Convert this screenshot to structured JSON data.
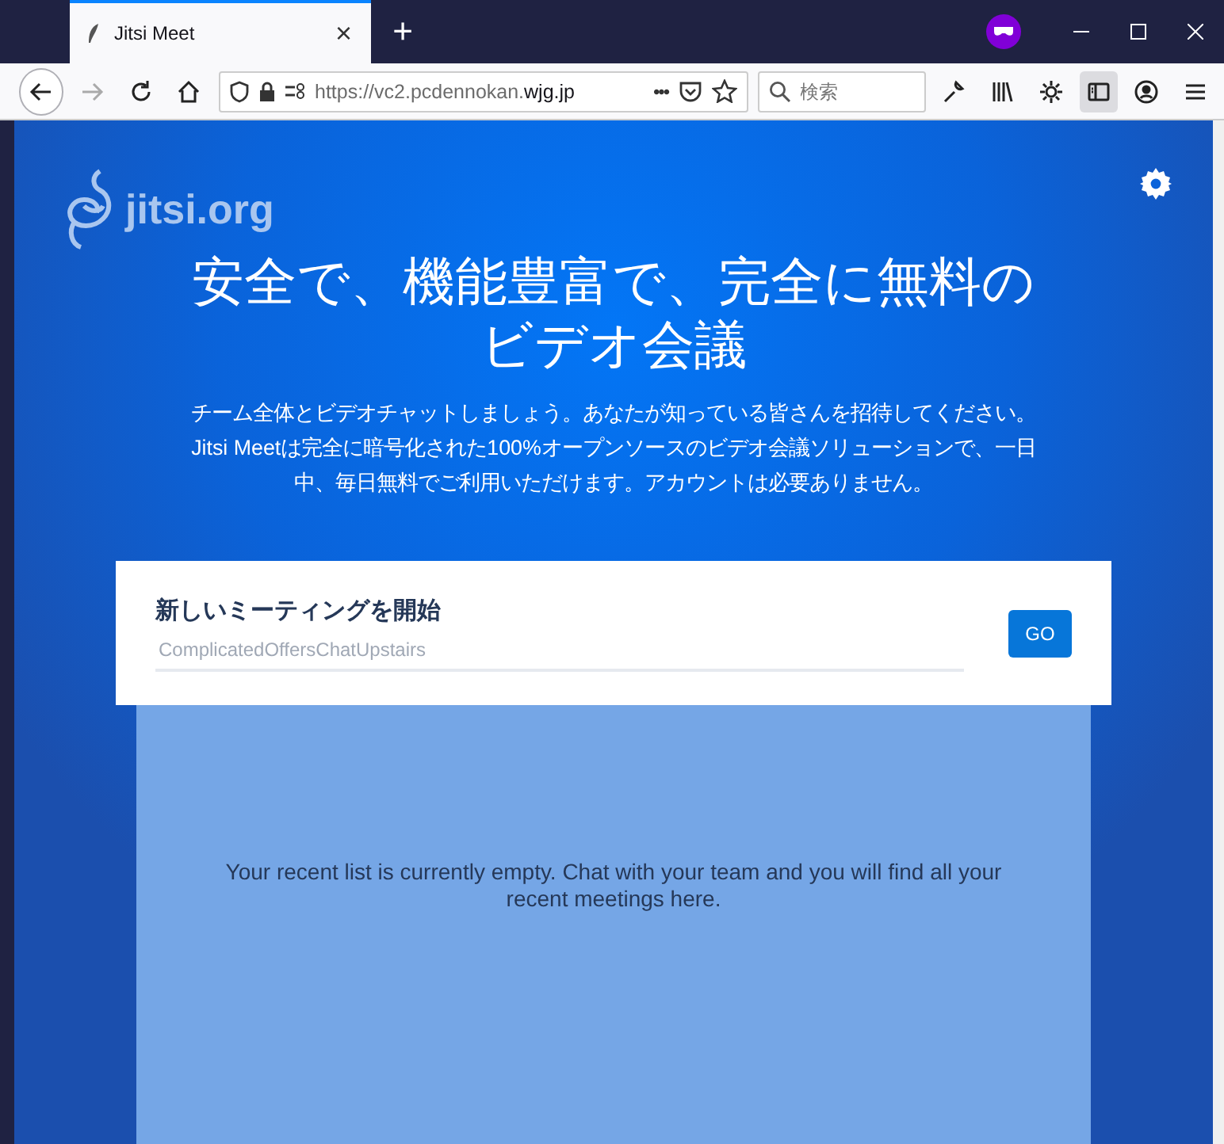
{
  "tab": {
    "title": "Jitsi Meet",
    "close": "×",
    "new_tab": "+",
    "selected": true
  },
  "toolbar": {
    "url_prefix": "https://vc2.pcdennokan.",
    "url_domain": "wjg.jp",
    "page_actions": "•••",
    "search_placeholder": "検索",
    "sidebar_on": true
  },
  "page": {
    "logo": "jitsi.org",
    "title": "安全で、機能豊富で、完全に無料のビデオ会議",
    "description": "チーム全体とビデオチャットしましょう。あなたが知っている皆さんを招待してください。Jitsi Meetは完全に暗号化された100%オープンソースのビデオ会議ソリューションで、一日中、毎日無料でご利用いただけます。アカウントは必要ありません。"
  },
  "meeting": {
    "heading": "新しいミーティングを開始",
    "placeholder": "ComplicatedOffersChatUpstairs",
    "button": "GO"
  },
  "recent": {
    "empty_message": "Your recent list is currently empty. Chat with your team and you will find all your recent meetings here."
  }
}
